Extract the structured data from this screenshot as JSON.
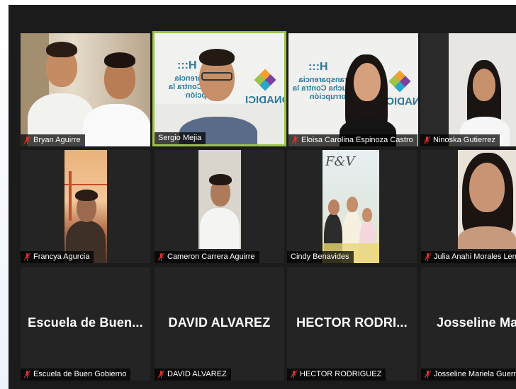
{
  "meeting": {
    "participants": [
      {
        "name": "Bryan Aguirre",
        "muted": true
      },
      {
        "name": "Sergio Mejia",
        "muted": false,
        "active_speaker": true
      },
      {
        "name": "Eloisa Carolina Espinoza Castro",
        "muted": true
      },
      {
        "name": "Ninoska Gutierrez",
        "muted": true
      },
      {
        "name": "Francya Agurcia",
        "muted": true
      },
      {
        "name": "Cameron Carrera Aguirre",
        "muted": true
      },
      {
        "name": "Cindy Benavides",
        "muted": false
      },
      {
        "name": "Julia Anahi Morales Lemu",
        "muted": true
      },
      {
        "name": "Escuela de Buen Gobierno",
        "muted": true,
        "display_label": "Escuela de Buen..."
      },
      {
        "name": "DAVID ALVAREZ",
        "muted": true,
        "display_label": "DAVID ALVAREZ"
      },
      {
        "name": "HECTOR RODRIGUEZ",
        "muted": true,
        "display_label": "HECTOR RODRI..."
      },
      {
        "name": "Josseline Mariela Guerra",
        "muted": true,
        "display_label": "Josseline Mari"
      }
    ],
    "banner": {
      "brand": "ONADICI",
      "letters": "H:::",
      "lines": [
        "Transparencia",
        "Lucha Contra la",
        "Corrupción"
      ]
    },
    "photo_initials": "F&V",
    "colors": {
      "active_border": "#9ec24a",
      "muted_icon": "#e0302c",
      "tile_bg": "#242424"
    }
  }
}
